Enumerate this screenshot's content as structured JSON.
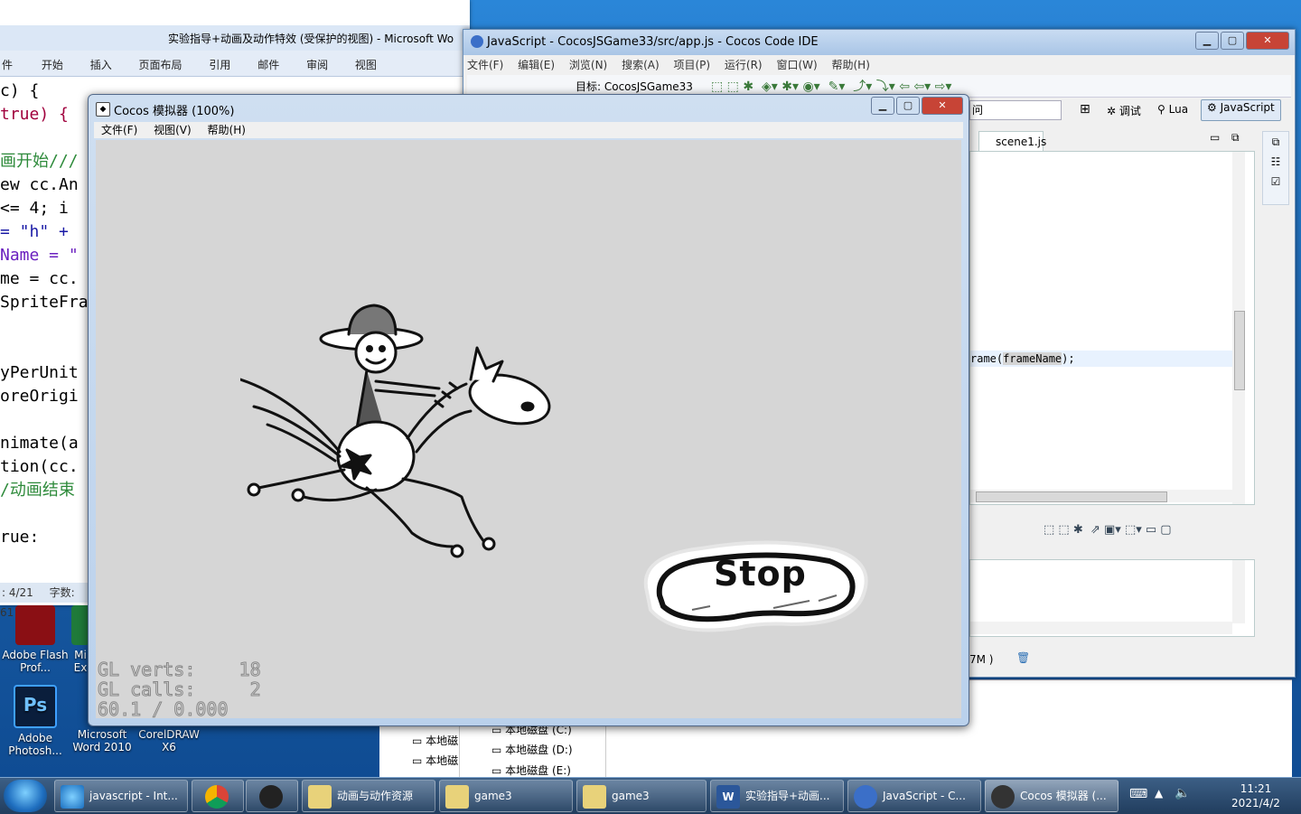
{
  "word": {
    "title": "实验指导+动画及动作特效 (受保护的视图) - Microsoft Wo",
    "ribbon_tabs": [
      "件",
      "开始",
      "插入",
      "页面布局",
      "引用",
      "邮件",
      "审阅",
      "视图"
    ],
    "code_lines": [
      "c) {",
      "",
      " true) {",
      "",
      "画开始///",
      "ew cc.An",
      " <= 4; i",
      " = \"h\" +",
      "Name = \"",
      "me = cc.",
      "SpriteFra",
      "",
      "",
      "yPerUnit",
      "oreOrigi",
      "",
      "nimate(a",
      "tion(cc.",
      "/动画结束",
      "",
      "rue:"
    ],
    "status_page": ": 4/21",
    "status_words": "字数: 61"
  },
  "ide": {
    "title": "JavaScript - CocosJSGame33/src/app.js - Cocos Code IDE",
    "menu": [
      "文件(F)",
      "编辑(E)",
      "浏览(N)",
      "搜索(A)",
      "项目(P)",
      "运行(R)",
      "窗口(W)",
      "帮助(H)"
    ],
    "target_label": "目标: CocosJSGame33",
    "search_fragment": "问",
    "perspective_debug": "调试",
    "perspective_lua": "Lua",
    "perspective_js": "JavaScript",
    "editor_tab": "scene1.js",
    "code_fragment_pre": "rame(",
    "code_fragment_arg": "frameName",
    "code_fragment_post": ");",
    "memory_fragment": "7M )"
  },
  "simulator": {
    "title": "Cocos 模拟器 (100%)",
    "menu": [
      "文件(F)",
      "视图(V)",
      "帮助(H)"
    ],
    "stop_label": "Stop",
    "stats_line1": "GL verts:    18",
    "stats_line2": "GL calls:     2",
    "stats_line3": "60.1 / 0.000"
  },
  "explorer": {
    "drives_left": [
      "本地磁",
      "本地磁"
    ],
    "drives": [
      "本地磁盘 (C:)",
      "本地磁盘 (D:)",
      "本地磁盘 (E:)"
    ]
  },
  "desktop_icons": [
    {
      "label": "Adobe Flash Prof...",
      "icon": "flash-icon"
    },
    {
      "label": "Mi Ex",
      "icon": "excel-icon"
    },
    {
      "label": "Adobe Photosh...",
      "icon": "photoshop-icon",
      "glyph": "Ps"
    },
    {
      "label": "Microsoft Word 2010",
      "icon": "word-icon"
    },
    {
      "label": "CorelDRAW X6",
      "icon": "coreldraw-icon"
    }
  ],
  "taskbar": {
    "items": [
      {
        "label": "javascript - Int...",
        "icon": "ie-icon"
      },
      {
        "label": "",
        "icon": "chrome-icon"
      },
      {
        "label": "",
        "icon": "nox-icon"
      },
      {
        "label": "动画与动作资源",
        "icon": "folder-icon"
      },
      {
        "label": "game3",
        "icon": "folder-icon"
      },
      {
        "label": "game3",
        "icon": "folder-icon"
      },
      {
        "label": "实验指导+动画...",
        "icon": "word-icon"
      },
      {
        "label": "JavaScript - C...",
        "icon": "cocos-ide-icon"
      },
      {
        "label": "Cocos 模拟器 (...",
        "icon": "cocos-sim-icon"
      }
    ],
    "time": "11:21",
    "date": "2021/4/2"
  },
  "colors": {
    "desktop": "#1c6fb8",
    "canvas": "#d6d6d6",
    "taskbar": "#213d5e",
    "close_red": "#c74436"
  }
}
